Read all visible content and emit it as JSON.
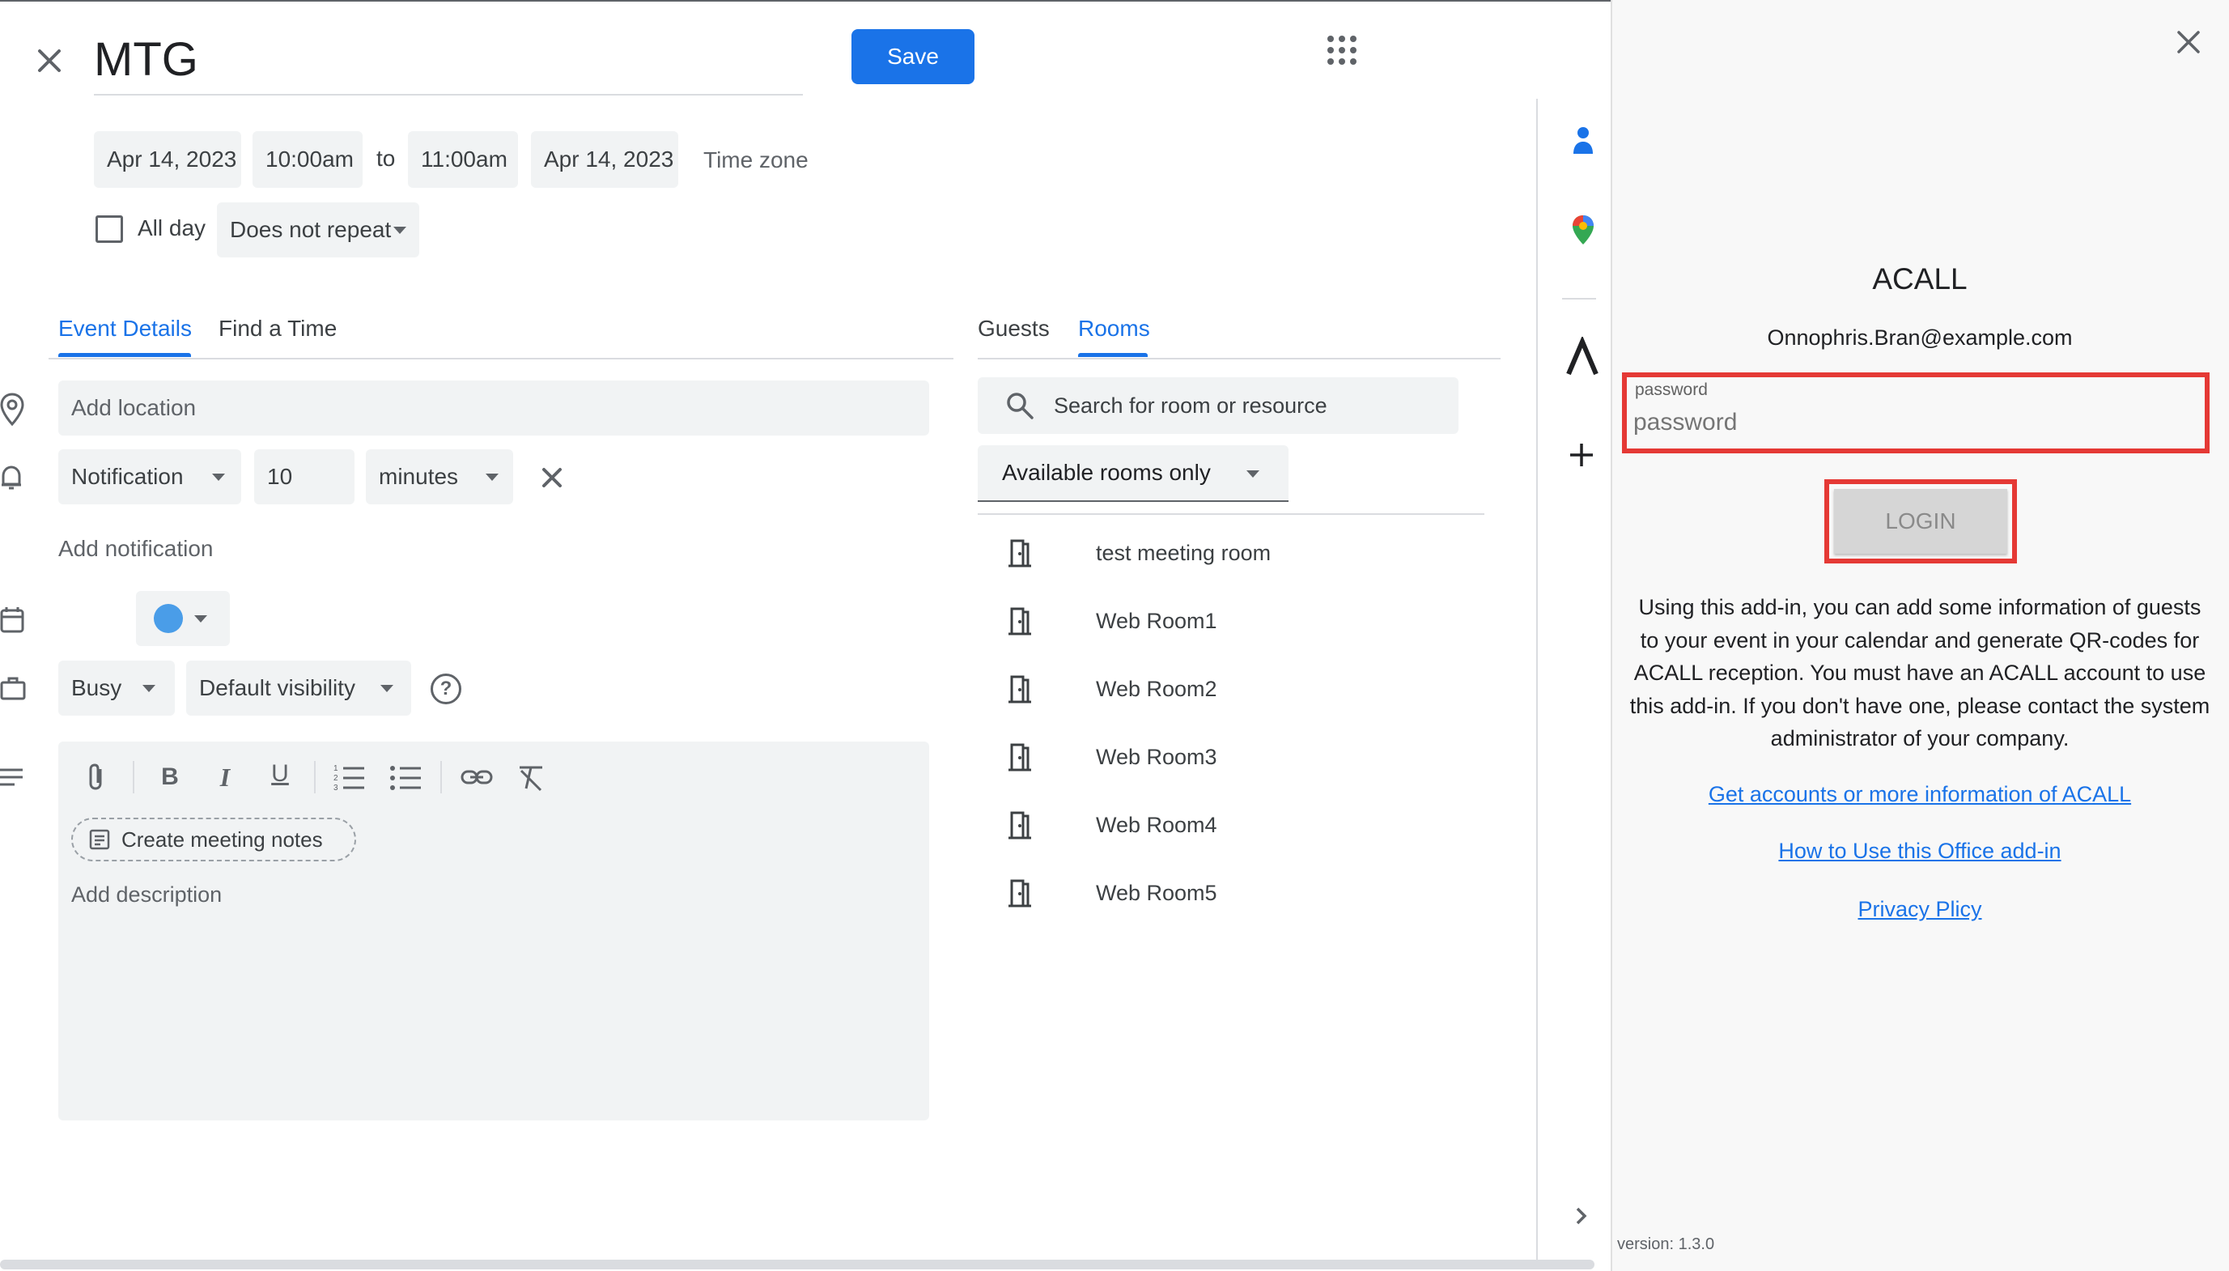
{
  "event": {
    "title": "MTG",
    "save_label": "Save",
    "start_date": "Apr 14, 2023",
    "start_time": "10:00am",
    "to_label": "to",
    "end_time": "11:00am",
    "end_date": "Apr 14, 2023",
    "time_zone_label": "Time zone",
    "all_day_label": "All day",
    "repeat_label": "Does not repeat"
  },
  "details_tabs": [
    {
      "label": "Event Details",
      "active": true
    },
    {
      "label": "Find a Time",
      "active": false
    }
  ],
  "details": {
    "location_placeholder": "Add location",
    "notification_type": "Notification",
    "notification_value": "10",
    "notification_unit": "minutes",
    "add_notification_label": "Add notification",
    "event_color": "#4a9de8",
    "busy_label": "Busy",
    "visibility_label": "Default visibility",
    "create_notes_label": "Create meeting notes",
    "description_placeholder": "Add description"
  },
  "guest_tabs": [
    {
      "label": "Guests",
      "active": false
    },
    {
      "label": "Rooms",
      "active": true
    }
  ],
  "rooms": {
    "search_placeholder": "Search for room or resource",
    "filter_label": "Available rooms only",
    "items": [
      {
        "label": "test meeting room"
      },
      {
        "label": "Web Room1"
      },
      {
        "label": "Web Room2"
      },
      {
        "label": "Web Room3"
      },
      {
        "label": "Web Room4"
      },
      {
        "label": "Web Room5"
      }
    ]
  },
  "side_rail": {
    "icons": [
      "contacts-icon",
      "maps-icon",
      "acall-addon-icon",
      "add-icon"
    ]
  },
  "addon": {
    "title": "ACALL",
    "email": "Onnophris.Bran@example.com",
    "password_label": "password",
    "password_placeholder": "password",
    "login_label": "LOGIN",
    "description": "Using this add-in, you can add some information of guests to your event in your calendar and generate QR-codes for ACALL reception. You must have an ACALL account to use this add-in. If you don't have one, please contact the system administrator of your company.",
    "link_accounts": "Get accounts or more information of ACALL",
    "link_howto": "How to Use this Office add-in",
    "link_privacy": "Privacy Plicy",
    "version": "version: 1.3.0"
  },
  "colors": {
    "accent": "#1a73e8",
    "highlight_box": "#e53935",
    "chip_bg": "#f1f3f4"
  }
}
